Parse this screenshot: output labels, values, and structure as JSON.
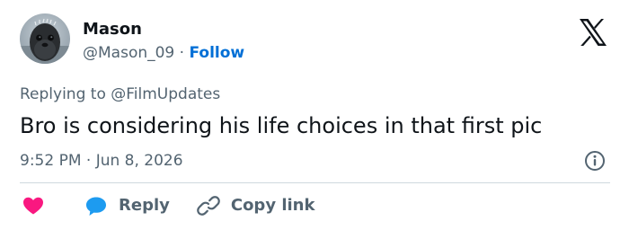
{
  "author": {
    "display_name": "Mason",
    "handle": "@Mason_09",
    "separator": " · ",
    "follow_label": "Follow"
  },
  "reply_context": {
    "prefix": "Replying to ",
    "mention": "@FilmUpdates"
  },
  "tweet": {
    "text": "Bro is considering his life choices in that first pic",
    "timestamp": "9:52 PM · Jun 8, 2026"
  },
  "actions": {
    "reply_label": "Reply",
    "copy_link_label": "Copy link"
  },
  "colors": {
    "text_primary": "#0f1419",
    "text_secondary": "#536471",
    "follow_blue": "#006fd6",
    "heart_pink": "#f91880",
    "reply_blue": "#1d9bf0",
    "divider": "#cfd9de"
  },
  "icons": [
    "x-logo-icon",
    "info-icon",
    "heart-icon",
    "reply-bubble-icon",
    "link-icon"
  ]
}
